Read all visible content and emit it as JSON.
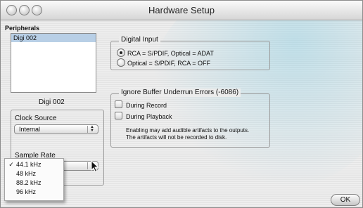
{
  "window": {
    "title": "Hardware Setup"
  },
  "peripherals": {
    "label": "Peripherals",
    "items": [
      "Digi 002"
    ],
    "selected_name": "Digi 002"
  },
  "clock_source": {
    "label": "Clock Source",
    "value": "Internal"
  },
  "sample_rate": {
    "label": "Sample Rate",
    "options": [
      {
        "label": "44.1 kHz",
        "checked": true
      },
      {
        "label": "48 kHz",
        "checked": false
      },
      {
        "label": "88.2 kHz",
        "checked": false
      },
      {
        "label": "96 kHz",
        "checked": false
      }
    ]
  },
  "digital_input": {
    "title": "Digital Input",
    "options": [
      {
        "label": "RCA = S/PDIF, Optical = ADAT",
        "selected": true
      },
      {
        "label": "Optical = S/PDIF, RCA = OFF",
        "selected": false
      }
    ]
  },
  "buffer_errors": {
    "title": "Ignore Buffer Underrun Errors (-6086)",
    "options": [
      {
        "label": "During Record",
        "checked": false
      },
      {
        "label": "During Playback",
        "checked": false
      }
    ],
    "note_line1": "Enabling may add audible artifacts to the outputs.",
    "note_line2": "The artifacts will not be recorded to disk."
  },
  "ok_button": "OK",
  "icons": {
    "checkmark": "✓",
    "popup_arrows": "▲▼"
  }
}
